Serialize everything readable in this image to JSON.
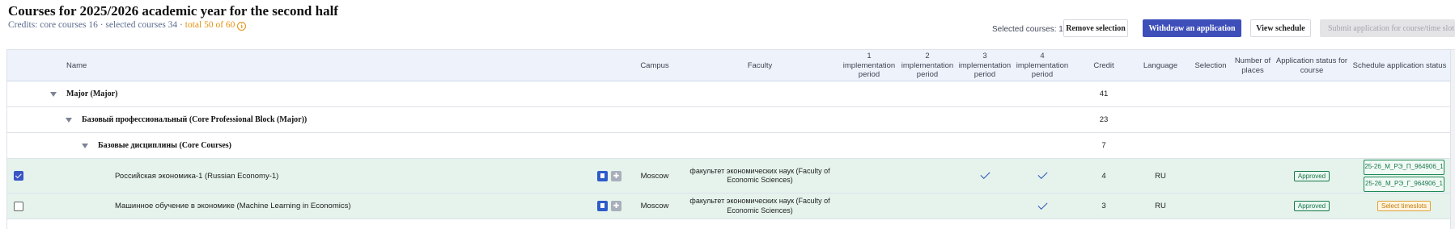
{
  "header": {
    "title": "Courses for 2025/2026 academic year for the second half",
    "credits_core": "Credits: core courses 16",
    "credits_selected": " · selected courses 34 · ",
    "credits_total": "total 50 of 60",
    "info_glyph": "i"
  },
  "toolbar": {
    "selected_count": "Selected courses: 1",
    "remove_label": "Remove selection",
    "withdraw_label": "Withdraw an application",
    "schedule_label": "View schedule",
    "submit_label": "Submit application for course/time slot"
  },
  "table": {
    "columns": {
      "name": "Name",
      "campus": "Campus",
      "faculty": "Faculty",
      "period1_num": "1",
      "period2_num": "2",
      "period3_num": "3",
      "period4_num": "4",
      "period_label": "implementation period",
      "credit": "Credit",
      "language": "Language",
      "selection": "Selection",
      "places": "Number of places",
      "app_status": "Application status for course",
      "schedule_status": "Schedule application status"
    },
    "groups": [
      {
        "label": "Major (Major)",
        "credit": "41"
      },
      {
        "label": "Базовый профессиональный (Core Professional Block (Major))",
        "credit": "23"
      },
      {
        "label": "Базовые дисциплины (Core Courses)",
        "credit": "7"
      }
    ],
    "courses": [
      {
        "name": "Российская экономика-1 (Russian Economy-1)",
        "selected": true,
        "campus": "Moscow",
        "faculty": "факультет экономических наук (Faculty of Economic Sciences)",
        "credit": "4",
        "language": "RU",
        "app_status": "Approved",
        "slots": [
          "25-26_М_РЭ_П_964906_1",
          "25-26_М_РЭ_Г_964906_1"
        ]
      },
      {
        "name": "Машинное обучение в экономике (Machine Learning in Economics)",
        "selected": false,
        "campus": "Moscow",
        "faculty": "факультет экономических наук (Faculty of Economic Sciences)",
        "credit": "3",
        "language": "RU",
        "app_status": "Approved",
        "schedule_action": "Select timeslots"
      }
    ]
  },
  "icons": {
    "pin": "✚"
  },
  "colors": {
    "primary": "#3e4fba",
    "approved": "#17784a",
    "warning": "#e69110",
    "row_selected": "#e5f3ec"
  }
}
